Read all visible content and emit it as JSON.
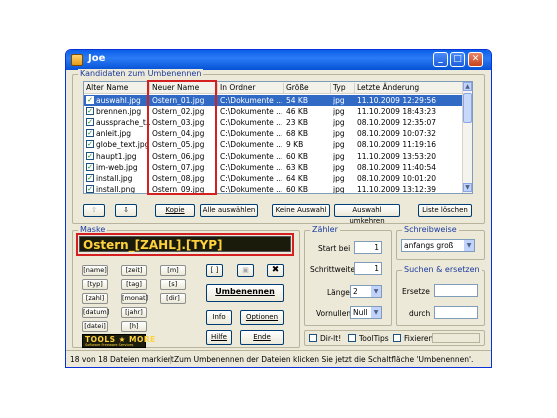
{
  "window": {
    "title": "Joe"
  },
  "kandidaten": {
    "label": "Kandidaten zum Umbenennen",
    "columns": [
      "Alter Name",
      "Neuer Name",
      "In Ordner",
      "Größe",
      "Typ",
      "Letzte Änderung"
    ],
    "rows": [
      {
        "checked": true,
        "old": "auswahl.jpg",
        "new": "Ostern_01.jpg",
        "folder": "C:\\Dokumente ...",
        "size": "54 KB",
        "type": "jpg",
        "date": "11.10.2009 12:29:56",
        "selected": true
      },
      {
        "checked": true,
        "old": "brennen.jpg",
        "new": "Ostern_02.jpg",
        "folder": "C:\\Dokumente ...",
        "size": "46 KB",
        "type": "jpg",
        "date": "11.10.2009 18:43:23"
      },
      {
        "checked": true,
        "old": "aussprache_t...",
        "new": "Ostern_03.jpg",
        "folder": "C:\\Dokumente ...",
        "size": "23 KB",
        "type": "jpg",
        "date": "08.10.2009 12:35:07"
      },
      {
        "checked": true,
        "old": "anleit.jpg",
        "new": "Ostern_04.jpg",
        "folder": "C:\\Dokumente ...",
        "size": "68 KB",
        "type": "jpg",
        "date": "08.10.2009 10:07:32"
      },
      {
        "checked": true,
        "old": "globe_text.jpg",
        "new": "Ostern_05.jpg",
        "folder": "C:\\Dokumente ...",
        "size": "9 KB",
        "type": "jpg",
        "date": "08.10.2009 11:19:16"
      },
      {
        "checked": true,
        "old": "haupt1.jpg",
        "new": "Ostern_06.jpg",
        "folder": "C:\\Dokumente ...",
        "size": "60 KB",
        "type": "jpg",
        "date": "11.10.2009 13:53:20"
      },
      {
        "checked": true,
        "old": "im-web.jpg",
        "new": "Ostern_07.jpg",
        "folder": "C:\\Dokumente ...",
        "size": "63 KB",
        "type": "jpg",
        "date": "08.10.2009 11:40:54"
      },
      {
        "checked": true,
        "old": "install.jpg",
        "new": "Ostern_08.jpg",
        "folder": "C:\\Dokumente ...",
        "size": "64 KB",
        "type": "jpg",
        "date": "08.10.2009 10:01:20"
      },
      {
        "checked": true,
        "old": "install.png",
        "new": "Ostern_09.jpg",
        "folder": "C:\\Dokumente ...",
        "size": "60 KB",
        "type": "jpg",
        "date": "11.10.2009 13:12:39"
      }
    ]
  },
  "list_buttons": {
    "up_icon": "arrow-up-icon",
    "down_icon": "arrow-down-icon",
    "kopie": "Kopie",
    "alle": "Alle auswählen",
    "keine": "Keine Auswahl",
    "umkehren": "Auswahl umkehren",
    "loeschen": "Liste löschen"
  },
  "maske": {
    "label": "Maske",
    "value": "Ostern_[ZAHL].[TYP]",
    "tokens": [
      "[name]",
      "[zeit]",
      "[m]",
      "[typ]",
      "[tag]",
      "[s]",
      "[zahl]",
      "[monat]",
      "[dir]",
      "[datum]",
      "[jahr]",
      "[datei]",
      "[h]"
    ],
    "brackets": "[ ]",
    "umbenennen": "Umbenennen",
    "info": "Info",
    "optionen": "Optionen",
    "hilfe": "Hilfe",
    "ende": "Ende"
  },
  "zaehler": {
    "label": "Zähler",
    "start_label": "Start bei",
    "start_value": "1",
    "schritt_label": "Schrittweite",
    "schritt_value": "1",
    "laenge_label": "Länge",
    "laenge_value": "2",
    "vornullen_label": "Vornullen",
    "vornullen_value": "Null"
  },
  "schreibweise": {
    "label": "Schreibweise",
    "value": "anfangs groß"
  },
  "suchen": {
    "label": "Suchen & ersetzen",
    "ersetze": "Ersetze",
    "durch": "durch"
  },
  "options": {
    "dirlt": "Dir-lt!",
    "tooltips": "ToolTips",
    "fixieren": "Fixieren"
  },
  "logo": {
    "text": "TOOLS ★ MORE",
    "sub": "Software Freeware Services"
  },
  "status": {
    "count": "18 von 18 Dateien markiert",
    "hint": "Zum Umbenennen der Dateien klicken Sie jetzt die Schaltfläche 'Umbenennen'."
  },
  "colors": {
    "selection": "#316ac5",
    "highlight_box": "#d42020",
    "titlebar": "#0a5fe8"
  }
}
